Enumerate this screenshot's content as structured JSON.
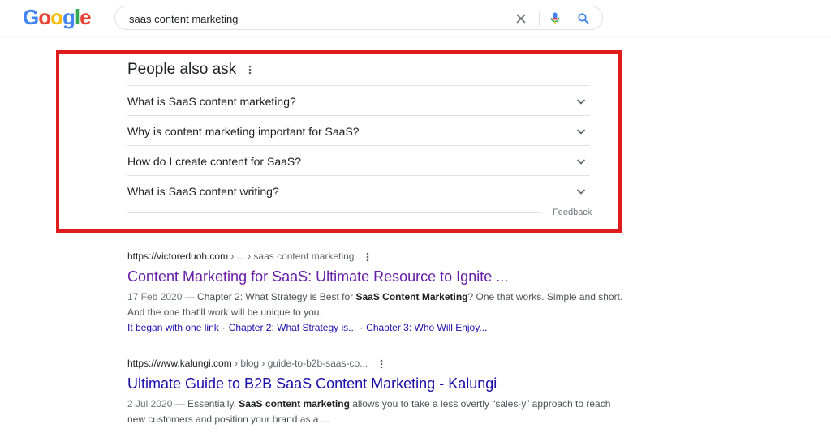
{
  "header": {
    "logo_letters": [
      "G",
      "o",
      "o",
      "g",
      "l",
      "e"
    ],
    "logo_colors": [
      "#4285f4",
      "#ea4335",
      "#fbbc05",
      "#4285f4",
      "#34a853",
      "#ea4335"
    ],
    "search_value": "saas content marketing"
  },
  "paa": {
    "title": "People also ask",
    "questions": [
      "What is SaaS content marketing?",
      "Why is content marketing important for SaaS?",
      "How do I create content for SaaS?",
      "What is SaaS content writing?"
    ],
    "feedback": "Feedback"
  },
  "results": [
    {
      "url_domain": "https://victoreduoh.com",
      "url_path": " › ... › saas content marketing",
      "title": "Content Marketing for SaaS: Ultimate Resource to Ignite ...",
      "date": "17 Feb 2020",
      "snippet_parts": [
        " — Chapter 2: What Strategy is Best for ",
        "SaaS Content Marketing",
        "? One that works. Simple and short. And the one that'll work will be unique to you."
      ],
      "sitelinks": [
        "It began with one link",
        "Chapter 2: What Strategy is...",
        "Chapter 3: Who Will Enjoy..."
      ]
    },
    {
      "url_domain": "https://www.kalungi.com",
      "url_path": " › blog › guide-to-b2b-saas-co...",
      "title": "Ultimate Guide to B2B SaaS Content Marketing - Kalungi",
      "date": "2 Jul 2020",
      "snippet_parts": [
        " — Essentially, ",
        "SaaS content marketing",
        " allows you to take a less overtly “sales-y” approach to reach new customers and position your brand as a ..."
      ]
    }
  ],
  "colors": {
    "highlight_border": "#e01b1b",
    "visited_link": "#681da8",
    "link": "#1a0dab"
  }
}
